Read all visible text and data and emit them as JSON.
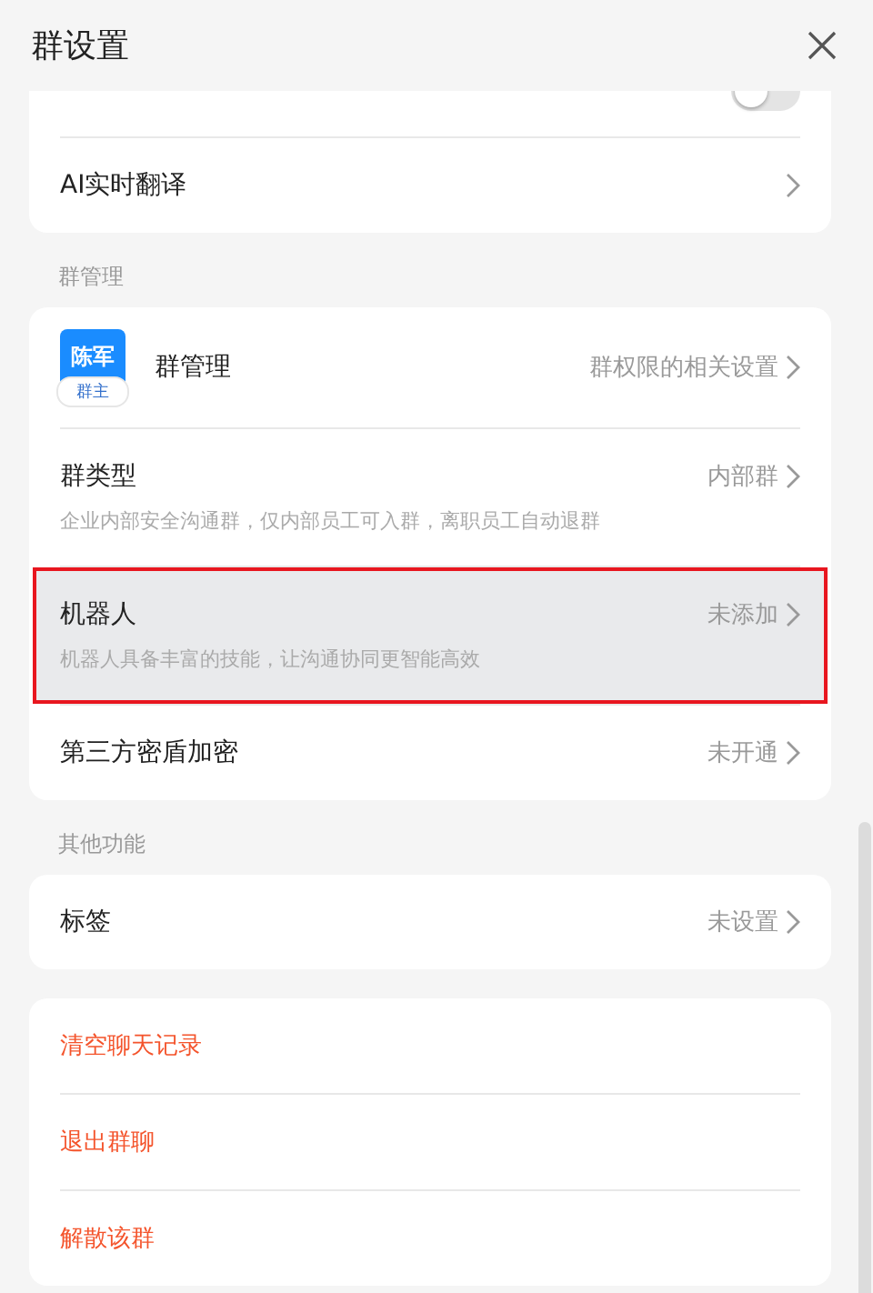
{
  "window": {
    "title": "群设置"
  },
  "sections": [
    {
      "rows": [
        {
          "kind": "toggle",
          "on": false
        },
        {
          "kind": "link",
          "label": "AI实时翻译"
        }
      ]
    },
    {
      "header": "群管理",
      "rows": [
        {
          "kind": "admin",
          "avatar_name": "陈军",
          "avatar_role": "群主",
          "label": "群管理",
          "value": "群权限的相关设置"
        },
        {
          "kind": "link",
          "label": "群类型",
          "value": "内部群",
          "description": "企业内部安全沟通群，仅内部员工可入群，离职员工自动退群"
        },
        {
          "kind": "link",
          "label": "机器人",
          "value": "未添加",
          "description": "机器人具备丰富的技能，让沟通协同更智能高效",
          "selected": true
        },
        {
          "kind": "link",
          "label": "第三方密盾加密",
          "value": "未开通"
        }
      ]
    },
    {
      "header": "其他功能",
      "rows": [
        {
          "kind": "link",
          "label": "标签",
          "value": "未设置"
        }
      ]
    },
    {
      "rows": [
        {
          "kind": "danger",
          "label": "清空聊天记录"
        },
        {
          "kind": "danger",
          "label": "退出群聊"
        },
        {
          "kind": "danger",
          "label": "解散该群"
        }
      ]
    }
  ]
}
